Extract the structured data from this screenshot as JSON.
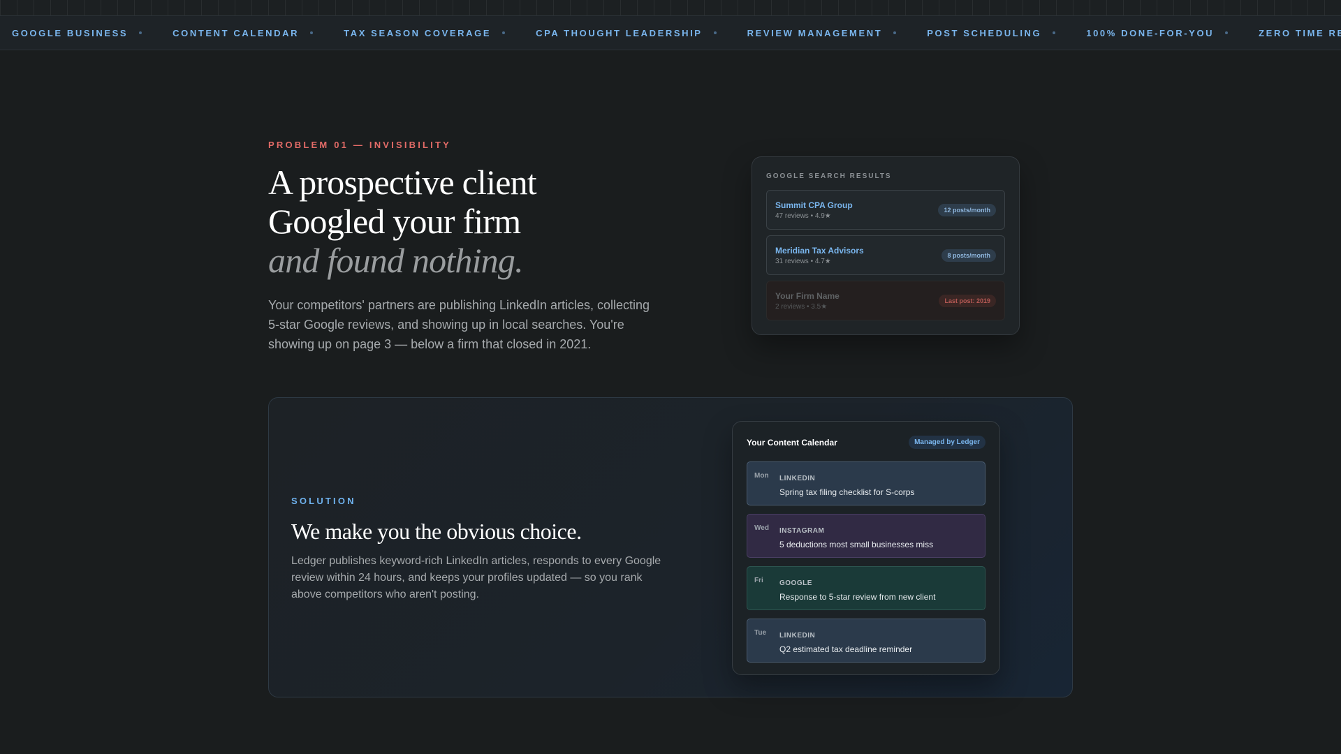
{
  "ticker": {
    "items": [
      "GOOGLE BUSINESS",
      "CONTENT CALENDAR",
      "TAX SEASON COVERAGE",
      "CPA THOUGHT LEADERSHIP",
      "REVIEW MANAGEMENT",
      "POST SCHEDULING",
      "100% DONE-FOR-YOU",
      "ZERO TIME REQUIRED"
    ]
  },
  "problem": {
    "eyebrow": "PROBLEM 01 — INVISIBILITY",
    "headline_line1": "A prospective client",
    "headline_line2": "Googled your firm",
    "headline_italic": "and found nothing.",
    "body": "Your competitors' partners are publishing LinkedIn articles, collecting 5-star Google reviews, and showing up in local searches. You're showing up on page 3 — below a firm that closed in 2021."
  },
  "search_card": {
    "eyebrow": "GOOGLE SEARCH RESULTS",
    "results": [
      {
        "name": "Summit CPA Group",
        "meta": "47 reviews • 4.9★",
        "badge": "12 posts/month"
      },
      {
        "name": "Meridian Tax Advisors",
        "meta": "31 reviews • 4.7★",
        "badge": "8 posts/month"
      },
      {
        "name": "Your Firm Name",
        "meta": "2 reviews • 3.5★",
        "badge": "Last post: 2019"
      }
    ]
  },
  "solution": {
    "eyebrow": "SOLUTION",
    "heading": "We make you the obvious choice.",
    "body": "Ledger publishes keyword-rich LinkedIn articles, responds to every Google review within 24 hours, and keeps your profiles updated — so you rank above competitors who aren't posting."
  },
  "calendar": {
    "title": "Your Content Calendar",
    "badge": "Managed by Ledger",
    "entries": [
      {
        "day": "Mon",
        "platform": "LINKEDIN",
        "topic": "Spring tax filing checklist for S-corps"
      },
      {
        "day": "Wed",
        "platform": "INSTAGRAM",
        "topic": "5 deductions most small businesses miss"
      },
      {
        "day": "Fri",
        "platform": "GOOGLE",
        "topic": "Response to 5-star review from new client"
      },
      {
        "day": "Tue",
        "platform": "LINKEDIN",
        "topic": "Q2 estimated tax deadline reminder"
      }
    ]
  },
  "colors": {
    "background": "#1a1d1e",
    "accent_blue": "#7ab6ee",
    "accent_red": "#e26b67"
  }
}
